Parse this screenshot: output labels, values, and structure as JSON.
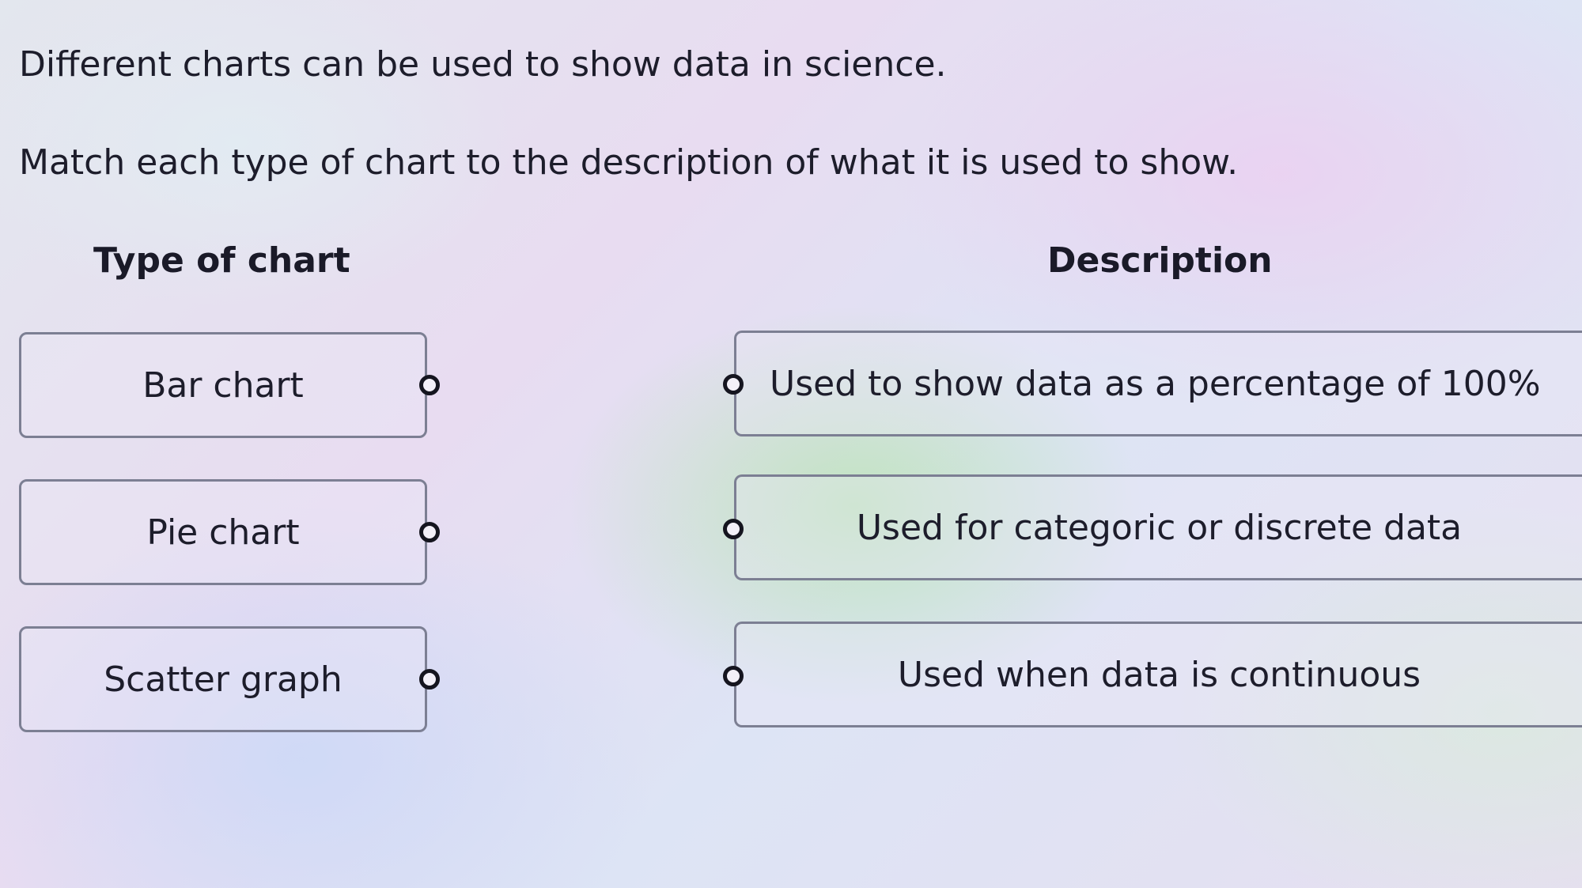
{
  "intro_text": "Different charts can be used to show data in science.",
  "instruction_text": "Match each type of chart to the description of what it is used to show.",
  "columns": {
    "left_header": "Type of chart",
    "right_header": "Description"
  },
  "chart_types": [
    {
      "label": "Bar chart"
    },
    {
      "label": "Pie chart"
    },
    {
      "label": "Scatter graph"
    }
  ],
  "descriptions": [
    {
      "label": "Used to show data as a percentage of 100%"
    },
    {
      "label": "Used for categoric or discrete data"
    },
    {
      "label": "Used when data is continuous"
    }
  ],
  "connector_icon": "hollow-circle-dot"
}
